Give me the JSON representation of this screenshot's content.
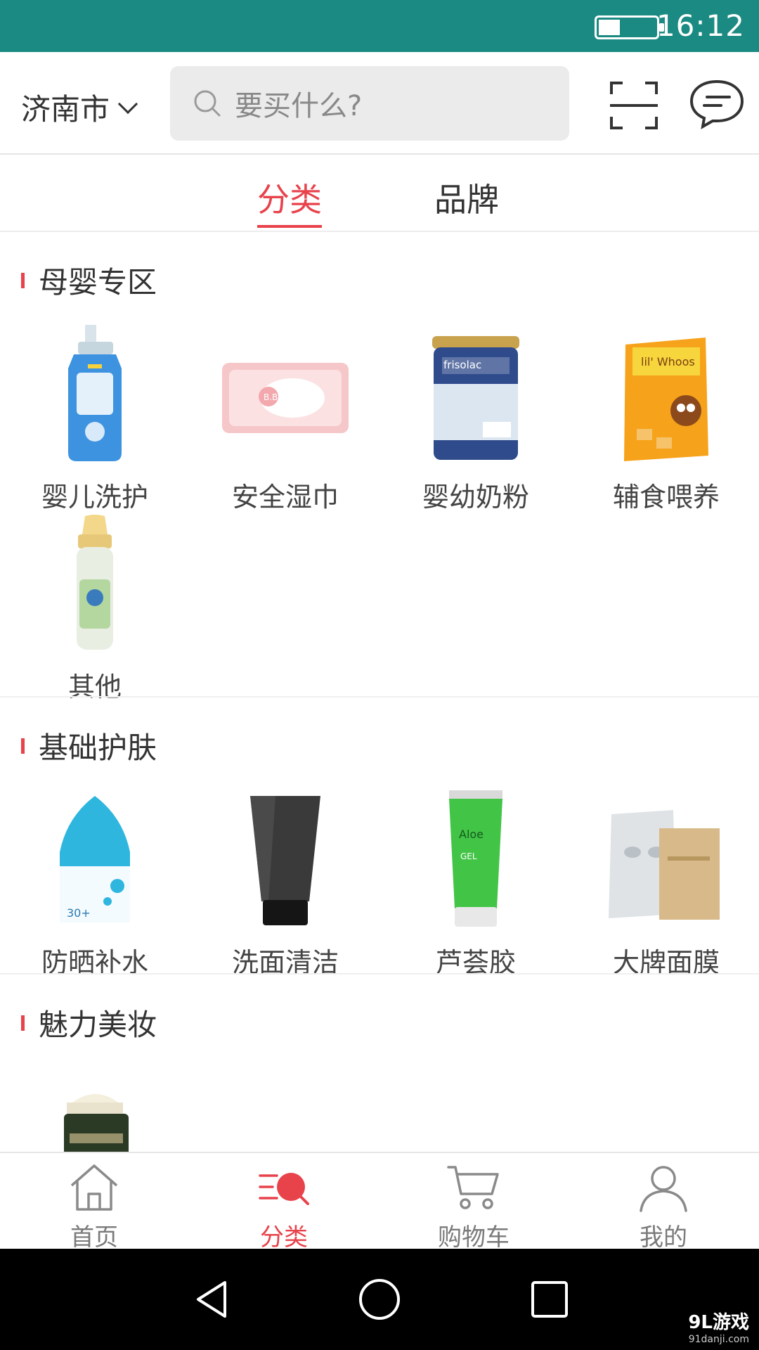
{
  "status": {
    "time": "16:12"
  },
  "header": {
    "city": "济南市",
    "search_placeholder": "要买什么?"
  },
  "tabs": [
    {
      "label": "分类",
      "active": true
    },
    {
      "label": "品牌",
      "active": false
    }
  ],
  "sections": [
    {
      "title": "母婴专区",
      "items": [
        {
          "label": "婴儿洗护"
        },
        {
          "label": "安全湿巾"
        },
        {
          "label": "婴幼奶粉"
        },
        {
          "label": "辅食喂养"
        },
        {
          "label": "其他"
        }
      ]
    },
    {
      "title": "基础护肤",
      "items": [
        {
          "label": "防晒补水"
        },
        {
          "label": "洗面清洁"
        },
        {
          "label": "芦荟胶"
        },
        {
          "label": "大牌面膜"
        }
      ]
    },
    {
      "title": "魅力美妆",
      "items": []
    }
  ],
  "bottom_nav": [
    {
      "label": "首页",
      "icon": "home-icon",
      "active": false
    },
    {
      "label": "分类",
      "icon": "category-icon",
      "active": true
    },
    {
      "label": "购物车",
      "icon": "cart-icon",
      "active": false
    },
    {
      "label": "我的",
      "icon": "user-icon",
      "active": false
    }
  ],
  "watermark": {
    "brand": "9L游戏",
    "url": "91danji.com"
  },
  "colors": {
    "accent": "#e8424b",
    "status_bar": "#1b8a82"
  }
}
